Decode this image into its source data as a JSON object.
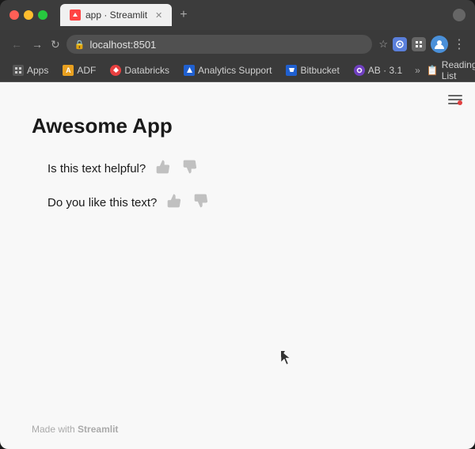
{
  "browser": {
    "tab": {
      "title": "app · Streamlit",
      "favicon_color": "#ff4444"
    },
    "url": "localhost:8501",
    "new_tab_label": "+",
    "bookmarks": [
      {
        "id": "apps",
        "label": "Apps",
        "icon_color": "#555",
        "icon_char": "⊞"
      },
      {
        "id": "adf",
        "label": "ADF",
        "icon_color": "#e8a020",
        "icon_char": "A"
      },
      {
        "id": "databricks",
        "label": "Databricks",
        "icon_color": "#e84040",
        "icon_char": "D"
      },
      {
        "id": "analytics-support",
        "label": "Analytics Support",
        "icon_color": "#2060d0",
        "icon_char": "◈"
      },
      {
        "id": "bitbucket",
        "label": "Bitbucket",
        "icon_color": "#2060d0",
        "icon_char": "⚑"
      },
      {
        "id": "ab",
        "label": "AB · 3.1",
        "icon_color": "#7040c0",
        "icon_char": "◉"
      }
    ],
    "reading_list_label": "Reading List"
  },
  "app": {
    "title": "Awesome App",
    "questions": [
      {
        "id": "q1",
        "text": "Is this text helpful?"
      },
      {
        "id": "q2",
        "text": "Do you like this text?"
      }
    ],
    "footer_made_with": "Made with",
    "footer_brand": "Streamlit"
  }
}
